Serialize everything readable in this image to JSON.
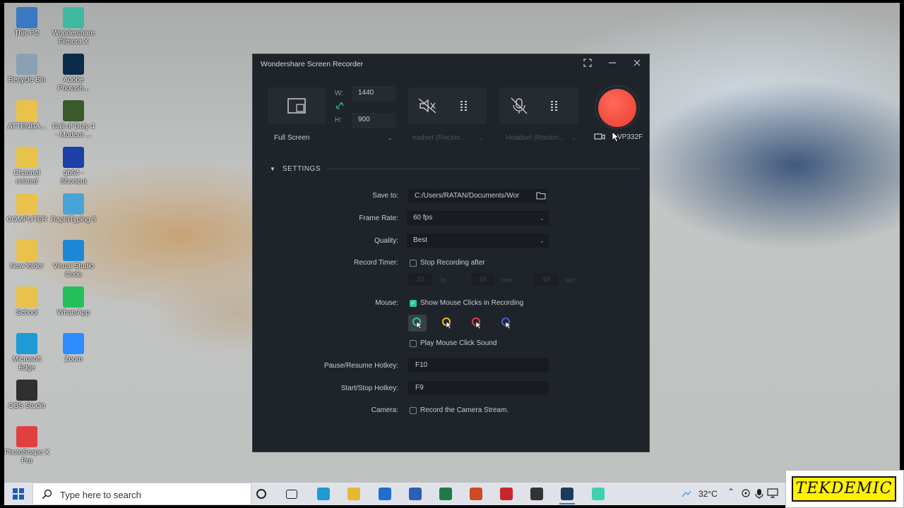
{
  "desktop": {
    "icons": [
      {
        "label": "This PC",
        "icon": "this-pc-icon",
        "color": "#3a78c2"
      },
      {
        "label": "Wondershare Filmora X",
        "icon": "filmora-icon",
        "color": "#3fb8a0"
      },
      {
        "label": "Recycle Bin",
        "icon": "recycle-bin-icon",
        "color": "#8aa0b5"
      },
      {
        "label": "Adobe Photosh...",
        "icon": "photoshop-icon",
        "color": "#0b2c4a"
      },
      {
        "label": "ATTENDA...",
        "icon": "folder-icon",
        "color": "#e8c24a"
      },
      {
        "label": "Call of Duty 4 - Modern ...",
        "icon": "game-icon",
        "color": "#3a5a2a"
      },
      {
        "label": "Channel related",
        "icon": "folder-icon",
        "color": "#e8c24a"
      },
      {
        "label": "qb64 - Shortcut",
        "icon": "qb64-icon",
        "color": "#1e3fa8"
      },
      {
        "label": "COMPUTER",
        "icon": "folder-icon",
        "color": "#e8c24a"
      },
      {
        "label": "RapidTyping 5",
        "icon": "rapidtyping-icon",
        "color": "#4aa3d8"
      },
      {
        "label": "New folder",
        "icon": "folder-icon",
        "color": "#e8c24a"
      },
      {
        "label": "Visual Studio Code",
        "icon": "vscode-icon",
        "color": "#1e88d8"
      },
      {
        "label": "School",
        "icon": "folder-icon",
        "color": "#e8c24a"
      },
      {
        "label": "WhatsApp",
        "icon": "whatsapp-icon",
        "color": "#25c05a"
      },
      {
        "label": "Microsoft Edge",
        "icon": "edge-icon",
        "color": "#1e9ad6"
      },
      {
        "label": "Zoom",
        "icon": "zoom-icon",
        "color": "#2d8cff"
      },
      {
        "label": "OBS Studio",
        "icon": "obs-icon",
        "color": "#303030"
      },
      {
        "label": "PhotoScape X Pro",
        "icon": "photoscape-icon",
        "color": "#e04040"
      }
    ]
  },
  "recorder": {
    "title": "Wondershare Screen Recorder",
    "region": {
      "width_label": "W:",
      "width_value": "1440",
      "height_label": "H:",
      "height_value": "900",
      "mode": "Full Screen"
    },
    "speaker_device": "eadset (Rocker...",
    "mic_device": "Headset (Rocker...",
    "camera_device": "VP332F",
    "settings_header": "SETTINGS",
    "settings": {
      "save_to_label": "Save to:",
      "save_to_value": "C:/Users/RATAN/Documents/Wor",
      "frame_rate_label": "Frame Rate:",
      "frame_rate_value": "60 fps",
      "quality_label": "Quality:",
      "quality_value": "Best",
      "record_timer_label": "Record Timer:",
      "stop_recording_label": "Stop Recording after",
      "timer_hr": "23",
      "timer_hr_unit": "hr",
      "timer_min": "59",
      "timer_min_unit": "min",
      "timer_sec": "59",
      "timer_sec_unit": "sec",
      "mouse_label": "Mouse:",
      "show_clicks_label": "Show Mouse Clicks in Recording",
      "show_clicks_checked": true,
      "cursor_colors": [
        "#2fc2a3",
        "#e8c020",
        "#e04050",
        "#4060e0"
      ],
      "play_click_sound_label": "Play Mouse Click Sound",
      "pause_hotkey_label": "Pause/Resume Hotkey:",
      "pause_hotkey_value": "F10",
      "start_hotkey_label": "Start/Stop Hotkey:",
      "start_hotkey_value": "F9",
      "camera_label": "Camera:",
      "camera_stream_label": "Record the Camera Stream."
    },
    "colors": {
      "record": "#f04a3c",
      "accent": "#2fc2a3",
      "background": "#1f242b"
    }
  },
  "taskbar": {
    "search_placeholder": "Type here to search",
    "temperature": "32°C",
    "apps": [
      "cortana-icon",
      "task-view-icon",
      "edge-icon",
      "file-explorer-icon",
      "mail-icon",
      "word-icon",
      "excel-icon",
      "powerpoint-icon",
      "acrobat-icon",
      "obs-icon",
      "recorder-icon",
      "filmora-icon"
    ]
  },
  "watermark": {
    "text": "TEKDEMIC"
  }
}
